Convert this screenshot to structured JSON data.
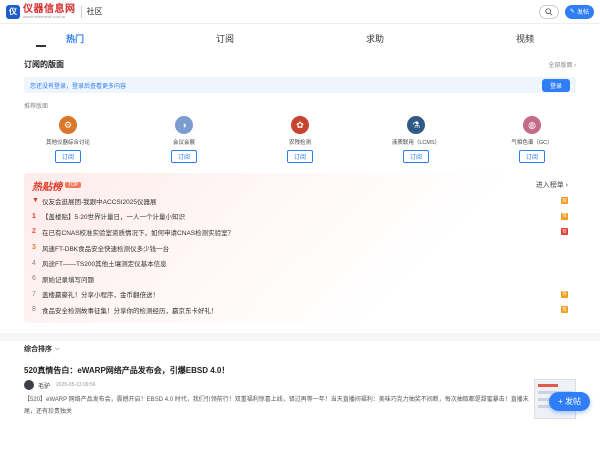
{
  "header": {
    "logo_mark": "仪",
    "logo_name": "仪器信息网",
    "logo_url": "www.instrument.com.cn",
    "section": "社区",
    "post_button": "发帖"
  },
  "tabs": [
    {
      "label": "热门"
    },
    {
      "label": "订阅"
    },
    {
      "label": "求助"
    },
    {
      "label": "视频"
    }
  ],
  "subscribed": {
    "title": "订阅的版面",
    "all_link": "全部版面 ›",
    "login_message": "您还没有登录，登录后查看更多内容",
    "login_button": "登录",
    "recommend_label": "推荐版面"
  },
  "boards": [
    {
      "name": "其他仪器综合讨论",
      "button": "订阅",
      "color": "#d9772a",
      "icon": "gear-icon"
    },
    {
      "name": "会议会展",
      "button": "订阅",
      "color": "#7a9ccf",
      "icon": "conference-icon"
    },
    {
      "name": "农残检测",
      "button": "订阅",
      "color": "#c7452f",
      "icon": "plant-icon"
    },
    {
      "name": "液质联用（LCMS）",
      "button": "订阅",
      "color": "#2f5a86",
      "icon": "flask-icon"
    },
    {
      "name": "气相色谱（GC）",
      "button": "订阅",
      "color": "#c46a8a",
      "icon": "chromatograph-icon"
    }
  ],
  "hot": {
    "title": "热贴榜",
    "badge": "TOP",
    "more": "进入榜单 ›",
    "items": [
      {
        "rank": "",
        "pinned": true,
        "text": "仪友会逛展团-我跟中ACCSI2025仪器展",
        "tag": "荐",
        "tag_color": "orange"
      },
      {
        "rank": "1",
        "pinned": false,
        "text": "【盖楼贴】5·20世界计量日，一人一个计量小知识",
        "tag": "荐",
        "tag_color": "orange"
      },
      {
        "rank": "2",
        "pinned": false,
        "text": "在已有CNAS校准实验室资质情况下，如何申请CNAS检测实验室？",
        "tag": "荐",
        "tag_color": "red"
      },
      {
        "rank": "3",
        "pinned": false,
        "text": "风速FT-DBK食品安全快速检测仪多少钱一台",
        "tag": "",
        "tag_color": ""
      },
      {
        "rank": "4",
        "pinned": false,
        "text": "风途FT——TS200其他土壤测定仪基本信息",
        "tag": "",
        "tag_color": ""
      },
      {
        "rank": "6",
        "pinned": false,
        "text": "原始记录填写问题",
        "tag": "",
        "tag_color": ""
      },
      {
        "rank": "7",
        "pinned": false,
        "text": "盖楼赢豪礼！分享小程序，金币翻倍送！",
        "tag": "荐",
        "tag_color": "orange"
      },
      {
        "rank": "8",
        "pinned": false,
        "text": "食品安全检测故事征集！分享你的检测经历，赢京东卡好礼！",
        "tag": "荐",
        "tag_color": "orange"
      }
    ]
  },
  "sort": {
    "label": "综合排序",
    "arrow": "⌵"
  },
  "post": {
    "title": "520真情告白：eWARP网络产品发布会，引爆EBSD 4.0！",
    "author": "毛驴",
    "time": "2025-05-13 09:56",
    "body": "【520】eWARP 网络产品发布会，震撼开启！EBSD 4.0 时代，我们引领前行！双重福利惊喜上线，错过再等一年！当天直播间福利：美味巧克力抽奖不间断，每次抽取都是甜蜜暴击！直播末尾，还有珍贵独关"
  },
  "float_button": "+ 发帖"
}
